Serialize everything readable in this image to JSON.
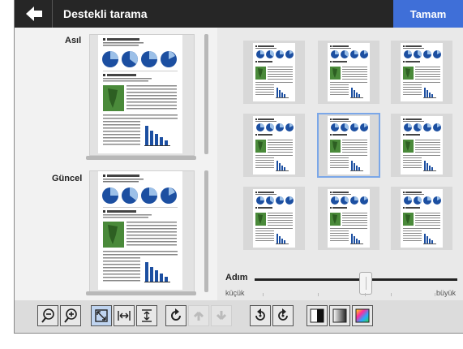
{
  "header": {
    "title": "Destekli tarama",
    "ok_label": "Tamam"
  },
  "left_panel": {
    "original_label": "Asıl",
    "current_label": "Güncel"
  },
  "slider": {
    "label": "Adım",
    "min_label": "küçük",
    "max_label": "büyük",
    "value_fraction": 0.5
  },
  "grid": {
    "selected_index": 4,
    "count": 9
  },
  "toolbar": {
    "icons": [
      "zoom-out-icon",
      "zoom-in-icon",
      "fit-page-icon",
      "fit-width-icon",
      "fit-height-icon",
      "rotate-icon",
      "prev-page-icon",
      "next-page-icon",
      "rotate-left-icon",
      "rotate-right-icon",
      "black-white-icon",
      "grayscale-icon",
      "color-icon"
    ]
  },
  "colors": {
    "accent": "#3f6fd8",
    "topbar": "#262626",
    "selected_outline": "#7ba7e8"
  }
}
